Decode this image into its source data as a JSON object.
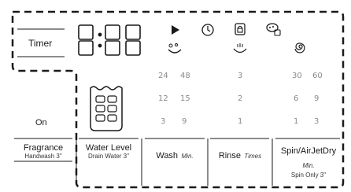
{
  "timer": {
    "label": "Timer",
    "display": "8:88"
  },
  "cycle_icons": [
    "start-pause-icon",
    "delay-end-icon",
    "child-lock-icon",
    "smart-control-icon"
  ],
  "on_label": "On",
  "labels": {
    "fragrance": {
      "main": "Fragrance",
      "sub": "Handwash 3\""
    },
    "water_level": {
      "main": "Water Level",
      "sub": "Drain Water 3\""
    },
    "wash": {
      "main": "Wash",
      "unit": "Min."
    },
    "rinse": {
      "main": "Rinse",
      "unit": "Times"
    },
    "spin": {
      "main": "Spin/AirJetDry",
      "unit": "Min.",
      "sub": "Spin Only 3\""
    }
  },
  "wash_values": [
    "24",
    "48",
    "12",
    "15",
    "3",
    "9"
  ],
  "rinse_values": [
    "3",
    "2",
    "1"
  ],
  "spin_values": [
    "30",
    "60",
    "6",
    "9",
    "1",
    "3"
  ]
}
